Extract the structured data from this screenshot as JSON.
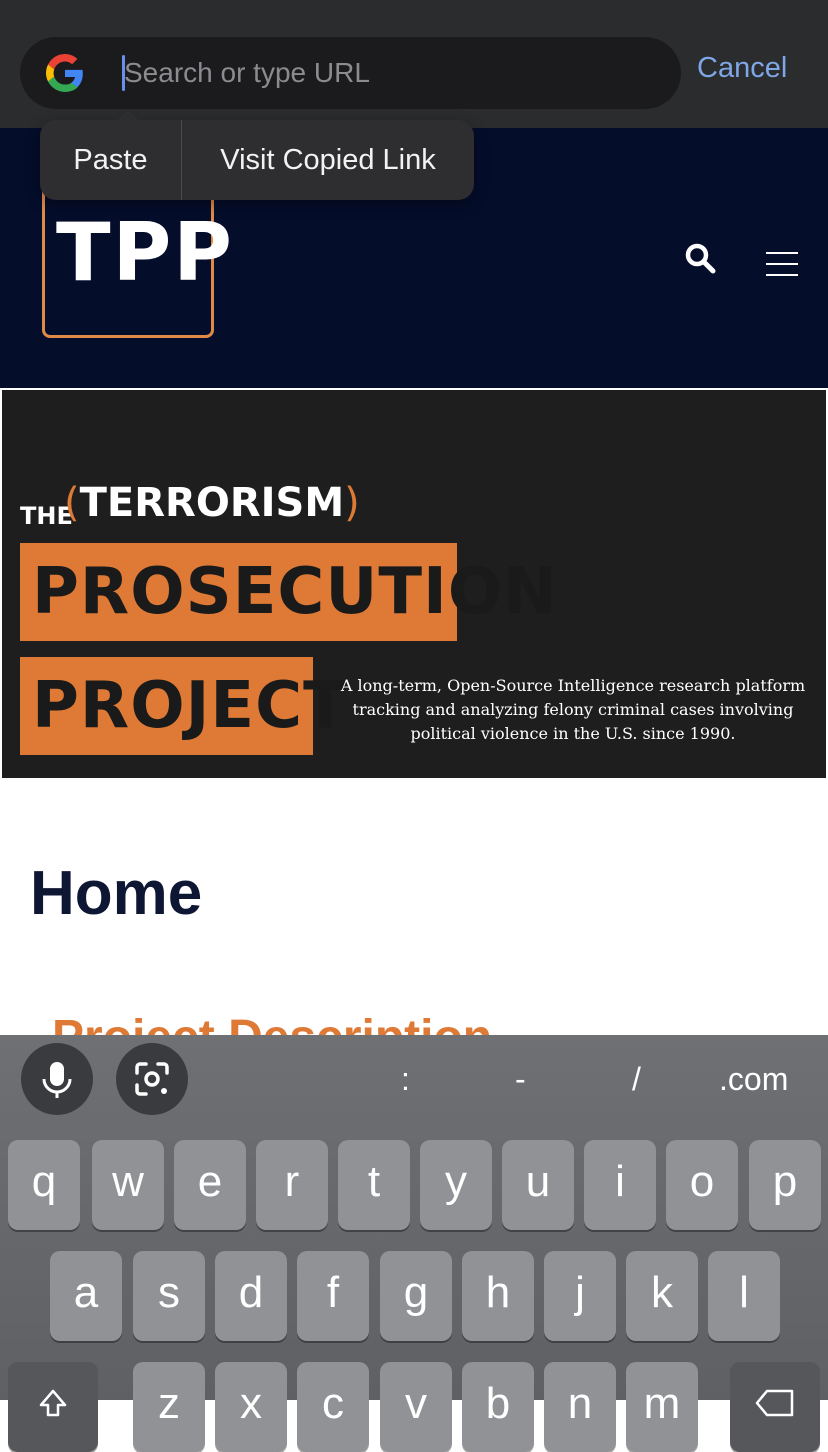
{
  "browser": {
    "search_placeholder": "Search or type URL",
    "cancel_label": "Cancel"
  },
  "paste_popup": {
    "paste_label": "Paste",
    "visit_label": "Visit Copied Link"
  },
  "site": {
    "logo_text": "TPP",
    "banner": {
      "the": "THE",
      "terrorism": "TERRORISM",
      "line1": "PROSECUTION",
      "line2": "PROJECT",
      "tagline": "A long-term, Open-Source Intelligence research platform tracking and analyzing felony criminal cases involving political violence in the U.S. since 1990."
    },
    "page_title": "Home",
    "section_heading": "Project Description"
  },
  "keyboard": {
    "suggestions": [
      ":",
      "-",
      "/",
      ".com"
    ],
    "row1": [
      "q",
      "w",
      "e",
      "r",
      "t",
      "y",
      "u",
      "i",
      "o",
      "p"
    ],
    "row2": [
      "a",
      "s",
      "d",
      "f",
      "g",
      "h",
      "j",
      "k",
      "l"
    ],
    "row3": [
      "z",
      "x",
      "c",
      "v",
      "b",
      "n",
      "m"
    ]
  },
  "colors": {
    "accent_orange": "#de7a36",
    "site_navy": "#040d2a",
    "link_blue": "#7fa6e6"
  }
}
